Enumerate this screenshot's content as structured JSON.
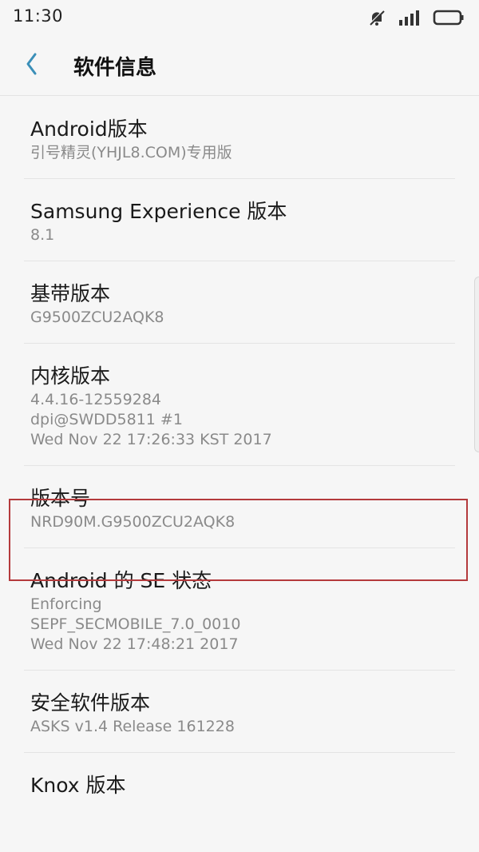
{
  "status_bar": {
    "time": "11:30",
    "icons": [
      "mute-icon",
      "signal-icon",
      "battery-icon"
    ]
  },
  "header": {
    "back_icon": "chevron-left-icon",
    "title": "软件信息",
    "accent_color": "#3b8fb8"
  },
  "items": [
    {
      "title": "Android版本",
      "values": [
        "引号精灵(YHJL8.COM)专用版"
      ]
    },
    {
      "title": "Samsung Experience 版本",
      "values": [
        "8.1"
      ]
    },
    {
      "title": "基带版本",
      "values": [
        "G9500ZCU2AQK8"
      ]
    },
    {
      "title": "内核版本",
      "values": [
        "4.4.16-12559284",
        "dpi@SWDD5811 #1",
        "Wed Nov 22 17:26:33 KST 2017"
      ]
    },
    {
      "title": "版本号",
      "values": [
        "NRD90M.G9500ZCU2AQK8"
      ]
    },
    {
      "title": "Android 的 SE 状态",
      "values": [
        "Enforcing",
        "SEPF_SECMOBILE_7.0_0010",
        "Wed Nov 22 17:48:21 2017"
      ]
    },
    {
      "title": "安全软件版本",
      "values": [
        "ASKS v1.4 Release 161228"
      ]
    },
    {
      "title": "Knox 版本",
      "values": []
    }
  ],
  "highlight_color": "#b43a3c"
}
